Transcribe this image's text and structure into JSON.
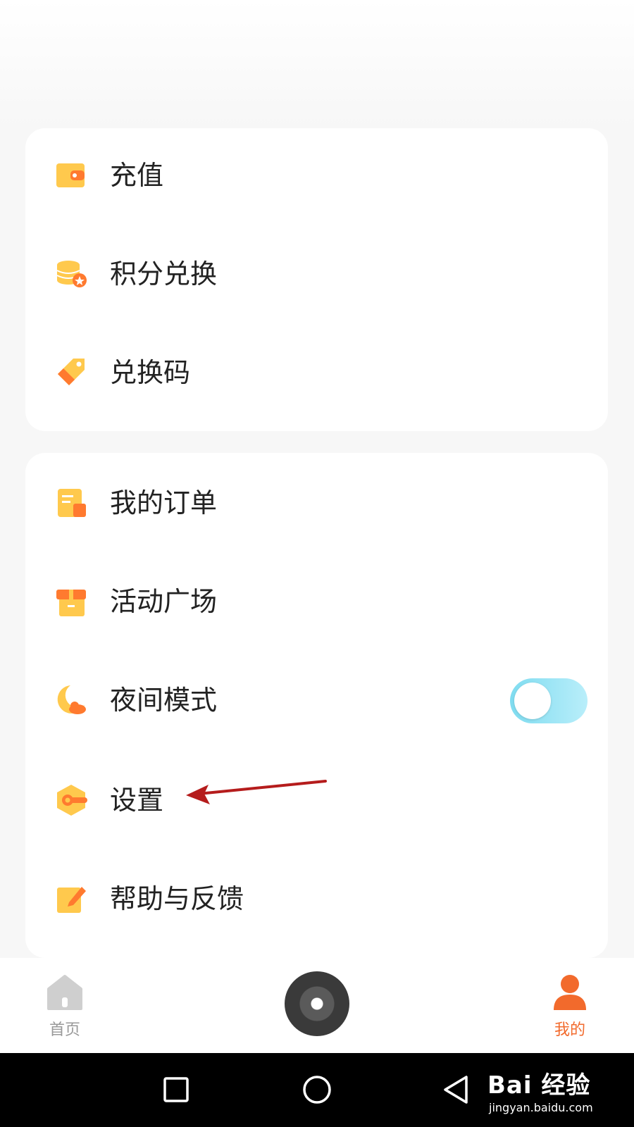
{
  "menu_group_1": [
    {
      "label": "充值",
      "icon": "wallet-icon"
    },
    {
      "label": "积分兑换",
      "icon": "coins-icon"
    },
    {
      "label": "兑换码",
      "icon": "tag-icon"
    }
  ],
  "menu_group_2": [
    {
      "label": "我的订单",
      "icon": "order-icon"
    },
    {
      "label": "活动广场",
      "icon": "gift-icon"
    },
    {
      "label": "夜间模式",
      "icon": "moon-icon",
      "toggle_on": false
    },
    {
      "label": "设置",
      "icon": "gear-icon"
    },
    {
      "label": "帮助与反馈",
      "icon": "edit-icon"
    }
  ],
  "tabbar": {
    "home_label": "首页",
    "mine_label": "我的",
    "active": "我的"
  },
  "watermark": {
    "main": "Bai 经验",
    "sub": "jingyan.baidu.com"
  },
  "colors": {
    "accent": "#f26a2c",
    "icon_yellow": "#ffc94d",
    "icon_orange": "#ff7a2f",
    "toggle": "#8fe2f3"
  }
}
